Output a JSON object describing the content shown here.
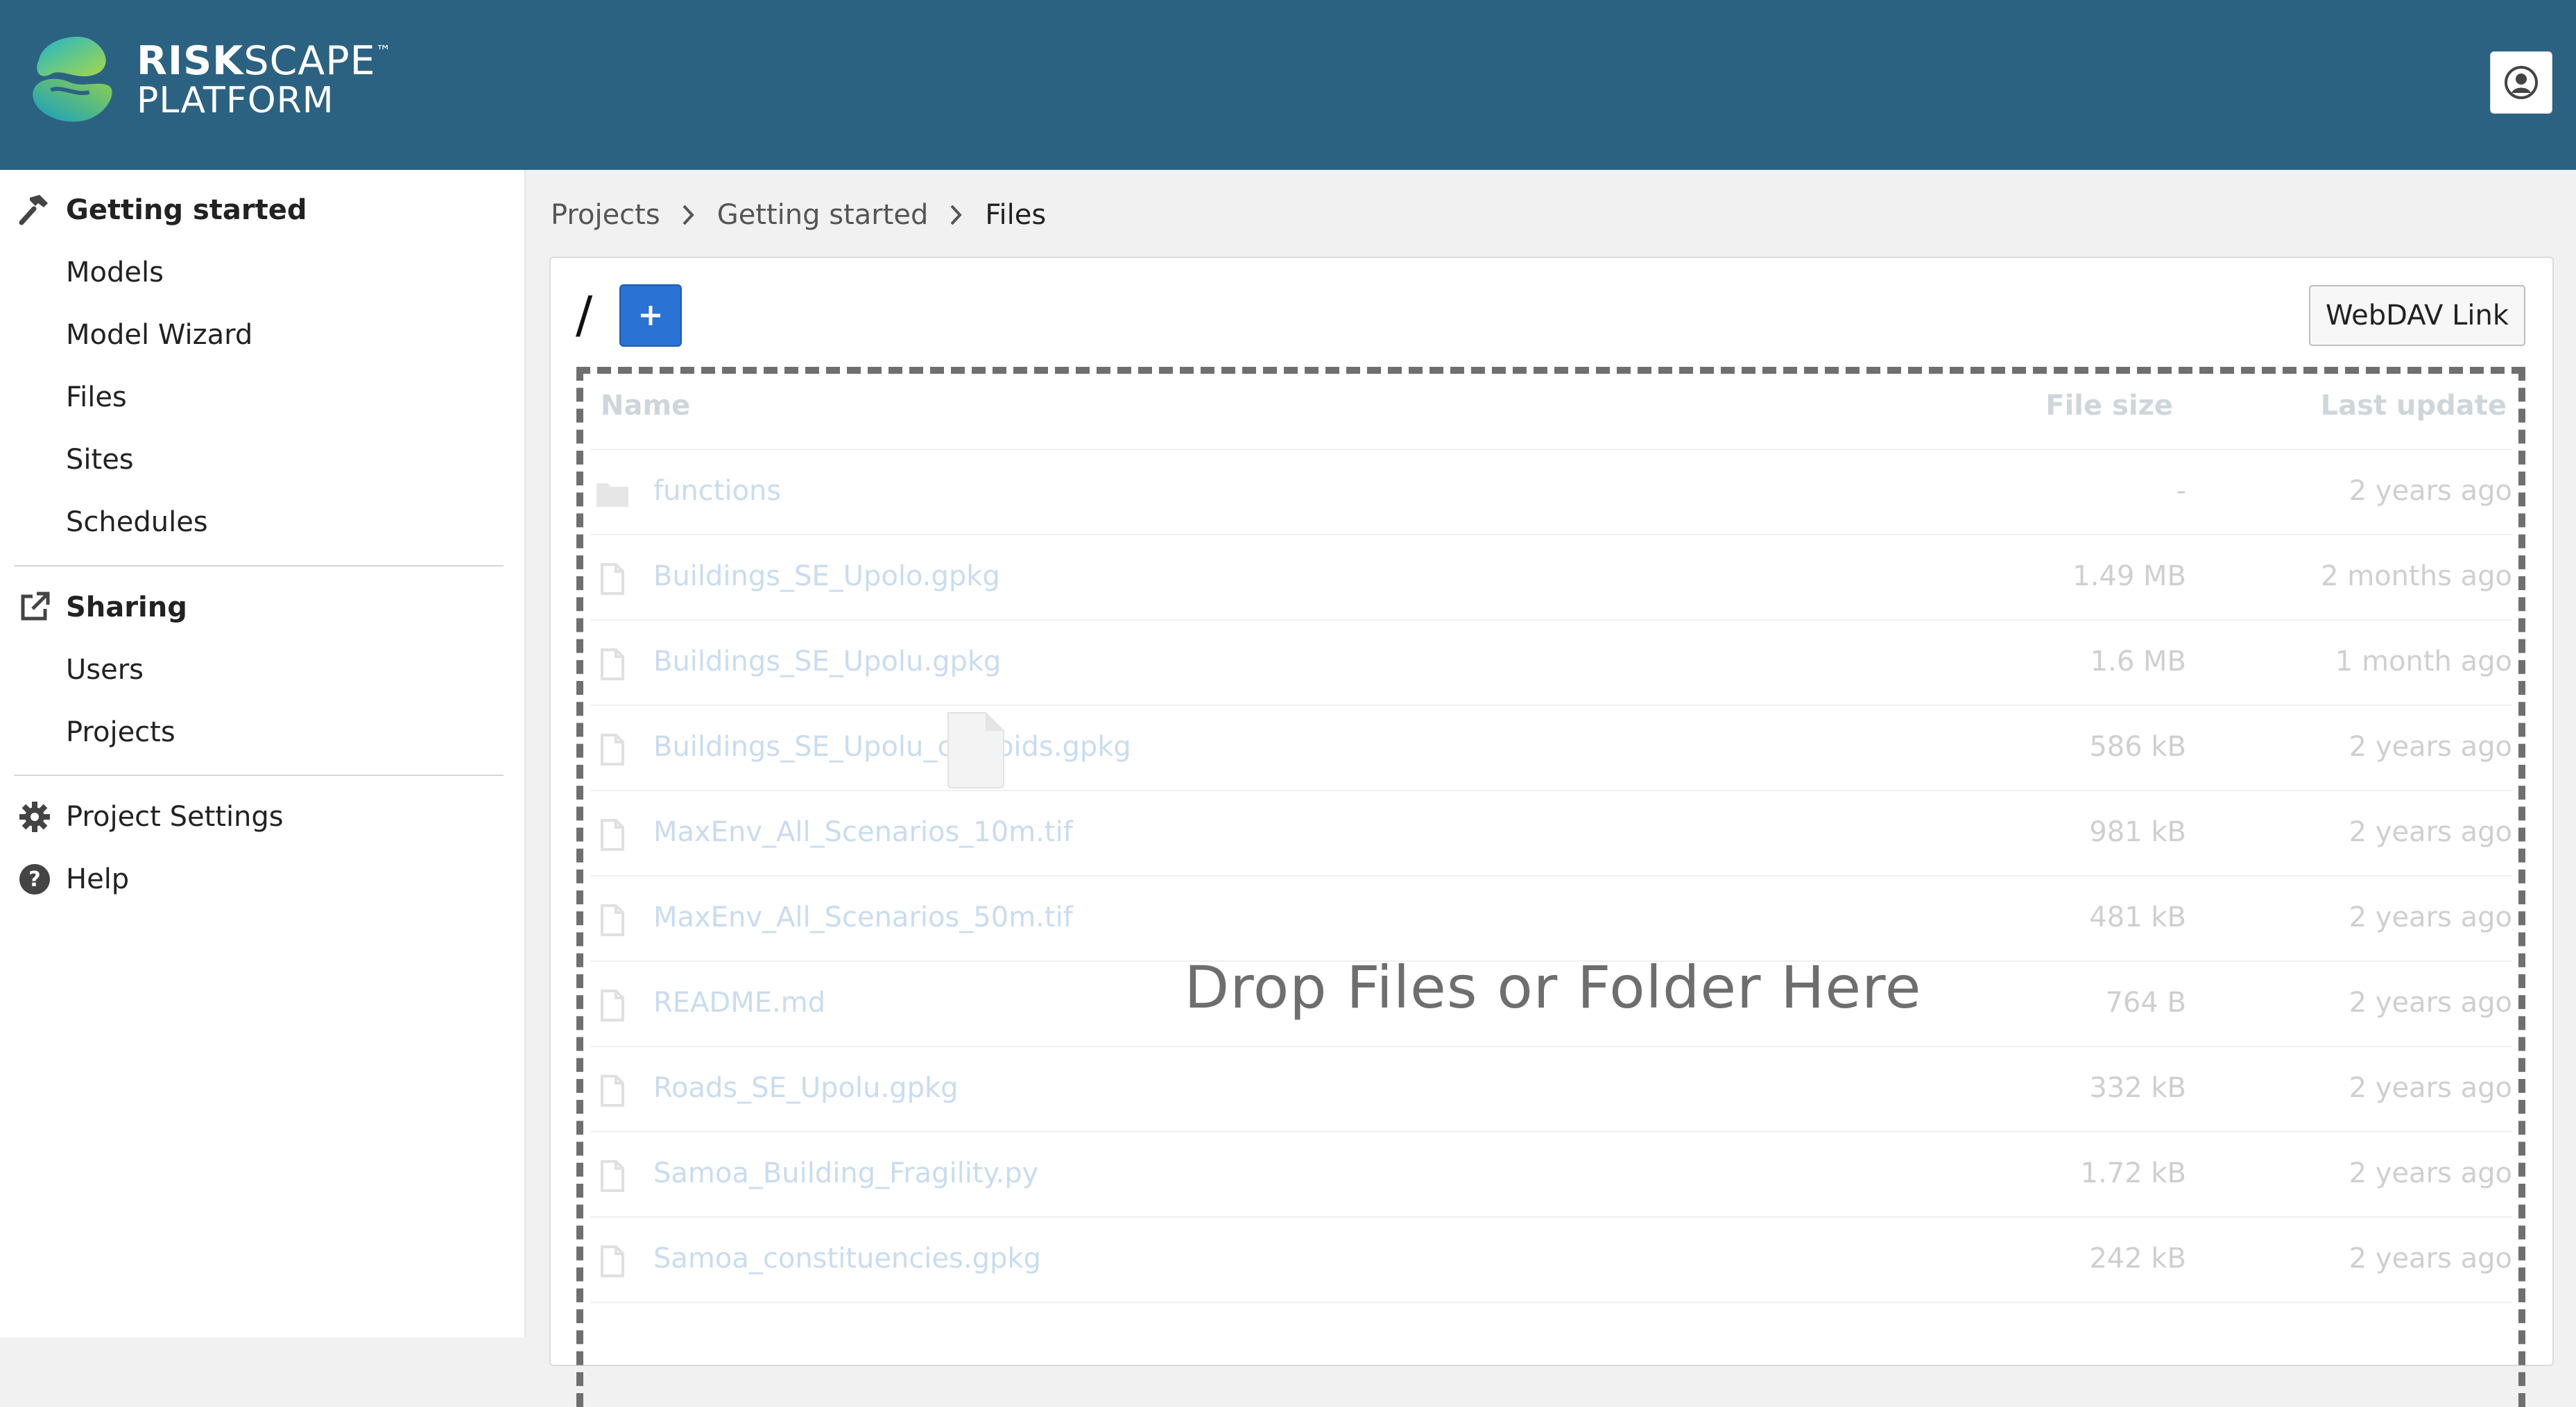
{
  "brand": {
    "line1_bold": "RISK",
    "line1_rest": "SCAPE",
    "tm": "™",
    "line2": "PLATFORM"
  },
  "header": {
    "user_icon": "user-circle-icon"
  },
  "sidebar": {
    "project_heading": "Getting started",
    "project_items": [
      "Models",
      "Model Wizard",
      "Files",
      "Sites",
      "Schedules"
    ],
    "sharing_heading": "Sharing",
    "sharing_items": [
      "Users",
      "Projects"
    ],
    "settings_label": "Project Settings",
    "help_label": "Help"
  },
  "breadcrumb": {
    "items": [
      "Projects",
      "Getting started"
    ],
    "current": "Files"
  },
  "browser": {
    "path": "/",
    "add_label": "+",
    "webdav_label": "WebDAV Link",
    "columns": {
      "name": "Name",
      "size": "File size",
      "updated": "Last update"
    },
    "drop_message": "Drop Files or Folder Here",
    "rows": [
      {
        "type": "folder",
        "name": "functions",
        "size": "-",
        "updated": "2 years ago"
      },
      {
        "type": "file",
        "name": "Buildings_SE_Upolo.gpkg",
        "size": "1.49 MB",
        "updated": "2 months ago"
      },
      {
        "type": "file",
        "name": "Buildings_SE_Upolu.gpkg",
        "size": "1.6 MB",
        "updated": "1 month ago"
      },
      {
        "type": "file",
        "name": "Buildings_SE_Upolu_c     oids.gpkg",
        "size": "586 kB",
        "updated": "2 years ago"
      },
      {
        "type": "file",
        "name": "MaxEnv_All_Scenarios_10m.tif",
        "size": "981 kB",
        "updated": "2 years ago"
      },
      {
        "type": "file",
        "name": "MaxEnv_All_Scenarios_50m.tif",
        "size": "481 kB",
        "updated": "2 years ago"
      },
      {
        "type": "file",
        "name": "README.md",
        "size": "764 B",
        "updated": "2 years ago"
      },
      {
        "type": "file",
        "name": "Roads_SE_Upolu.gpkg",
        "size": "332 kB",
        "updated": "2 years ago"
      },
      {
        "type": "file",
        "name": "Samoa_Building_Fragility.py",
        "size": "1.72 kB",
        "updated": "2 years ago"
      },
      {
        "type": "file",
        "name": "Samoa_constituencies.gpkg",
        "size": "242 kB",
        "updated": "2 years ago"
      }
    ]
  }
}
